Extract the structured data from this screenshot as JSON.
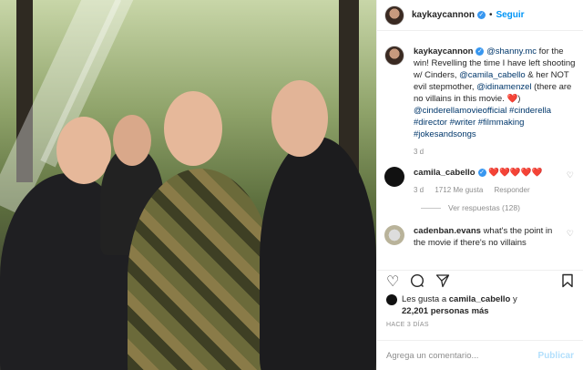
{
  "header": {
    "username": "kaykaycannon",
    "follow_label": "Seguir",
    "dot": "•"
  },
  "caption": {
    "username": "kaykaycannon",
    "text_1": "@shanny.mc",
    "text_2": " for the win! Revelling the time I have left shooting w/ Cinders, ",
    "text_3": "@camila_cabello",
    "text_4": " & her NOT evil stepmother, ",
    "text_5": "@idinamenzel",
    "text_6": " (there are no villains in this movie. ",
    "text_7": "❤️",
    "text_8": ") ",
    "text_9": "@cinderellamovieofficial",
    "text_10": " #cinderella #director #writer #filmmaking #jokesandsongs",
    "time": "3 d"
  },
  "comments": [
    {
      "username": "camila_cabello",
      "text": "❤️❤️❤️❤️❤️",
      "time": "3 d",
      "likes": "1712 Me gusta",
      "reply": "Responder",
      "view_replies": "Ver respuestas (128)"
    },
    {
      "username": "cadenban.evans",
      "text": "what's the point in the movie if there's no villains"
    }
  ],
  "actions": {
    "like_icon": "heart-outline-icon",
    "comment_icon": "comment-icon",
    "share_icon": "paper-plane-icon",
    "save_icon": "bookmark-icon"
  },
  "likes": {
    "prefix": "Les gusta a ",
    "user": "camila_cabello",
    "middle": " y ",
    "count": "22,201 personas más"
  },
  "posted_ago": "HACE 3 DÍAS",
  "add_comment": {
    "placeholder": "Agrega un comentario...",
    "publish_label": "Publicar"
  },
  "colors": {
    "accent": "#0095f6",
    "verified": "#3897f0",
    "muted": "#8e8e8e"
  }
}
